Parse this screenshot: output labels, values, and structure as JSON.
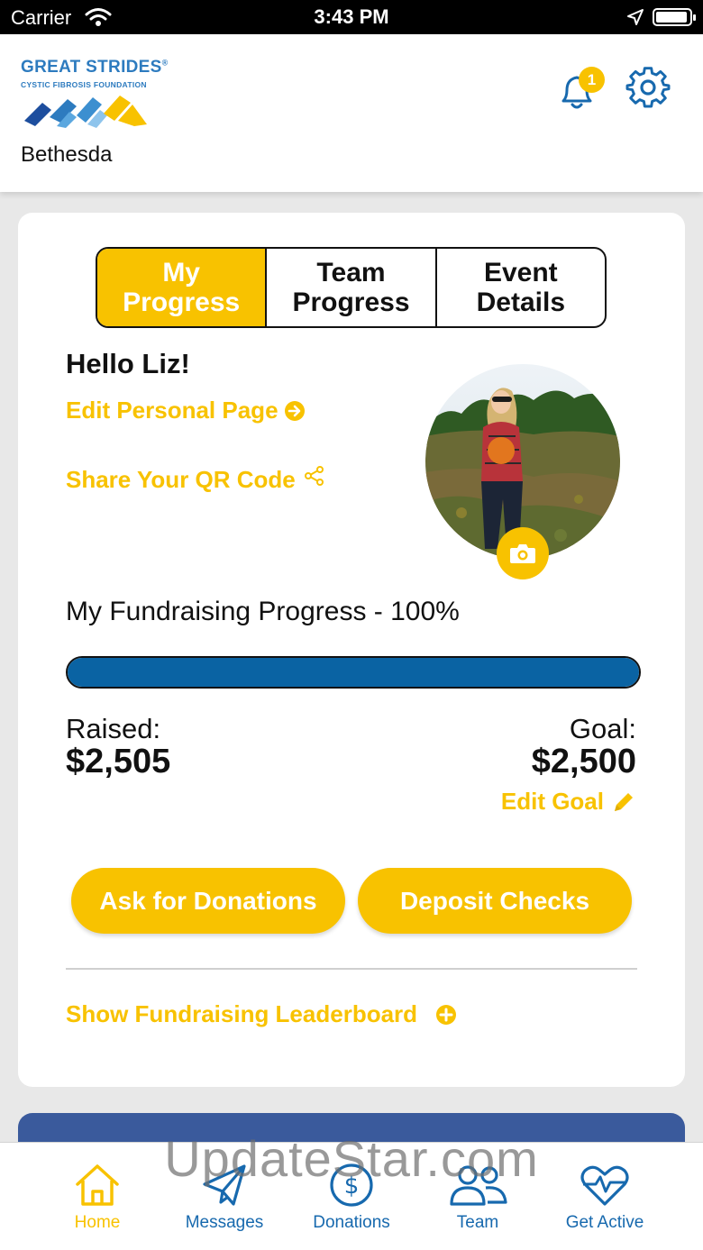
{
  "status_bar": {
    "carrier": "Carrier",
    "time": "3:43 PM"
  },
  "header": {
    "logo_title": "GREAT STRIDES",
    "logo_registered": "®",
    "logo_subtitle": "CYSTIC FIBROSIS FOUNDATION",
    "location": "Bethesda",
    "notification_count": "1"
  },
  "tabs": [
    {
      "label": "My\nProgress",
      "active": true
    },
    {
      "label": "Team\nProgress",
      "active": false
    },
    {
      "label": "Event\nDetails",
      "active": false
    }
  ],
  "profile": {
    "greeting": "Hello Liz!",
    "edit_page_label": "Edit Personal Page",
    "share_qr_label": "Share Your QR Code"
  },
  "fundraising": {
    "title": "My Fundraising Progress - 100%",
    "progress_fraction": 1.0,
    "raised_label": "Raised:",
    "raised_value": "$2,505",
    "goal_label": "Goal:",
    "goal_value": "$2,500",
    "edit_goal_label": "Edit Goal"
  },
  "actions": {
    "ask_donations": "Ask for Donations",
    "deposit_checks": "Deposit Checks",
    "leaderboard": "Show Fundraising Leaderboard"
  },
  "nav": [
    {
      "label": "Home",
      "icon": "home-icon",
      "active": true
    },
    {
      "label": "Messages",
      "icon": "paper-plane-icon",
      "active": false
    },
    {
      "label": "Donations",
      "icon": "dollar-circle-icon",
      "active": false
    },
    {
      "label": "Team",
      "icon": "people-icon",
      "active": false
    },
    {
      "label": "Get Active",
      "icon": "heart-pulse-icon",
      "active": false
    }
  ],
  "watermark": "UpdateStar.com",
  "colors": {
    "accent": "#f8c200",
    "primary_blue": "#0a63a3",
    "nav_blue": "#1769ae",
    "banner_blue": "#3a5a9c"
  }
}
